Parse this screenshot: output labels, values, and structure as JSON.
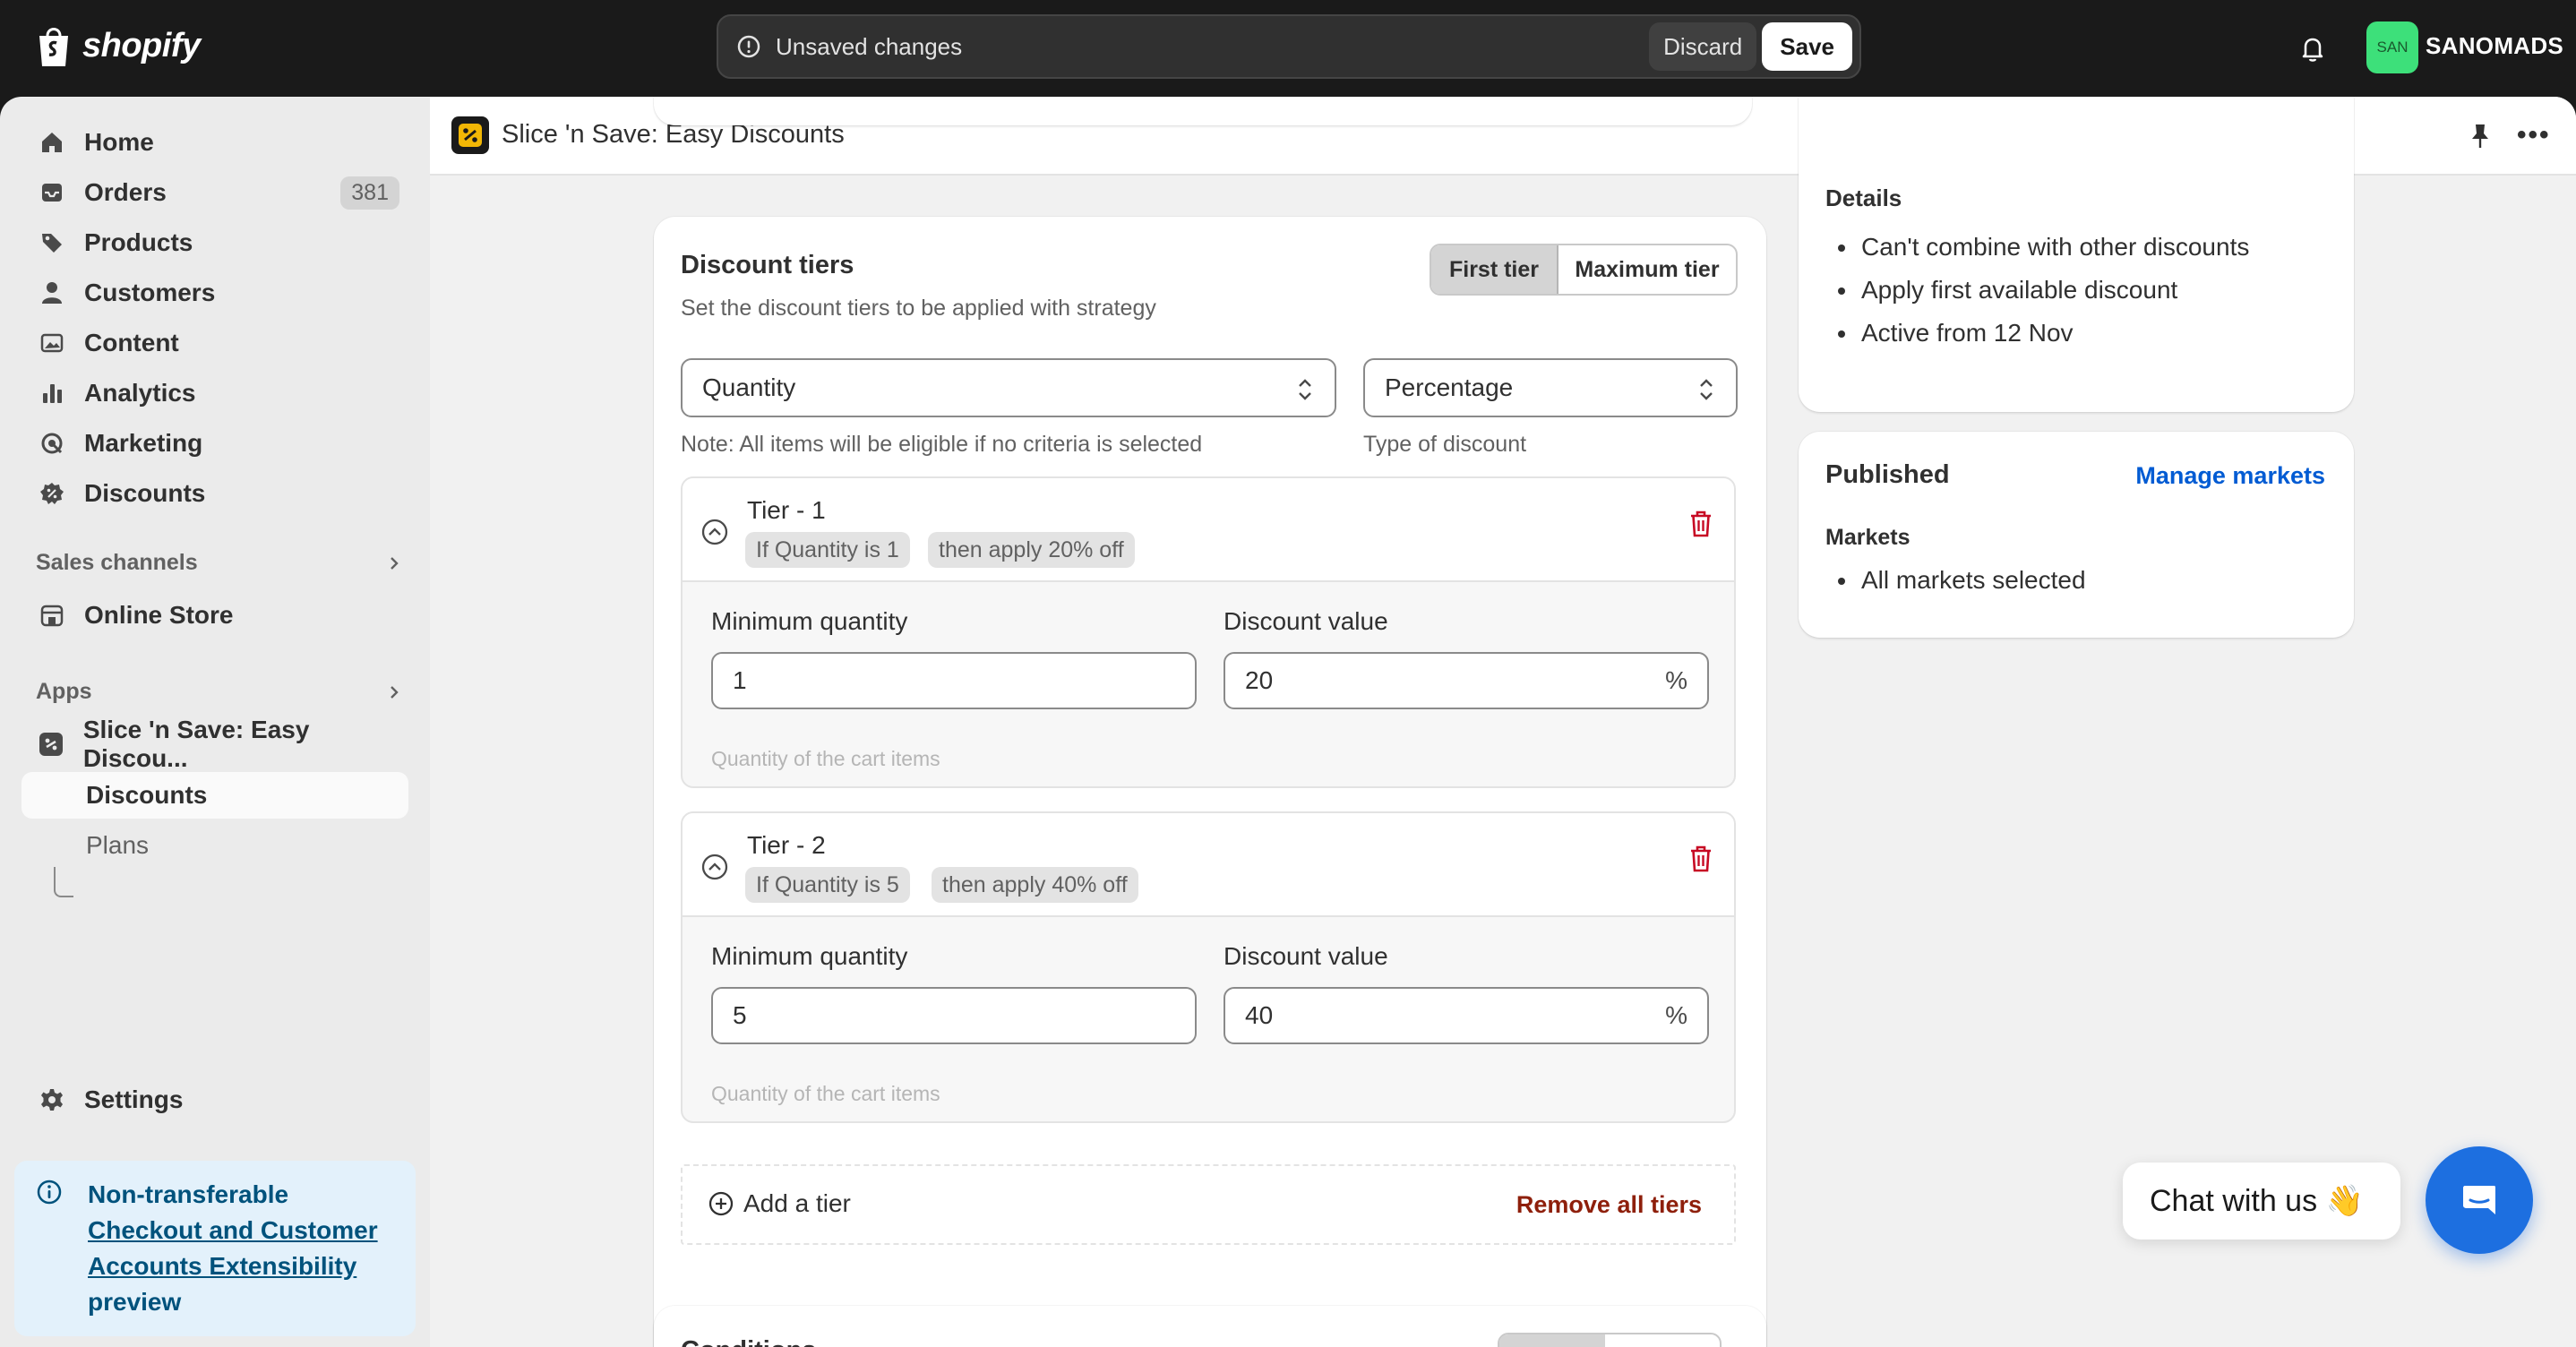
{
  "topbar": {
    "brand": "shopify",
    "unsaved_message": "Unsaved changes",
    "discard_label": "Discard",
    "save_label": "Save",
    "avatar_initials": "SAN",
    "store_name": "SANOMADS"
  },
  "sidebar": {
    "items": [
      {
        "label": "Home",
        "icon": "home-icon"
      },
      {
        "label": "Orders",
        "icon": "inbox-icon",
        "badge": "381"
      },
      {
        "label": "Products",
        "icon": "tag-icon"
      },
      {
        "label": "Customers",
        "icon": "person-icon"
      },
      {
        "label": "Content",
        "icon": "image-icon"
      },
      {
        "label": "Analytics",
        "icon": "bar-chart-icon"
      },
      {
        "label": "Marketing",
        "icon": "target-icon"
      },
      {
        "label": "Discounts",
        "icon": "discount-icon"
      }
    ],
    "sales_channels_label": "Sales channels",
    "online_store_label": "Online Store",
    "apps_label": "Apps",
    "app_name": "Slice 'n Save: Easy Discou...",
    "app_sub_items": [
      "Discounts",
      "Plans"
    ],
    "settings_label": "Settings",
    "banner": {
      "prefix": "Non-transferable",
      "link": "Checkout and Customer Accounts Extensibility",
      "suffix": "preview"
    }
  },
  "app_header": {
    "title": "Slice 'n Save: Easy Discounts"
  },
  "discount_tiers": {
    "title": "Discount tiers",
    "subtitle": "Set the discount tiers to be applied with strategy",
    "segments": [
      "First tier",
      "Maximum tier"
    ],
    "selected_segment": "First tier",
    "criteria_select": "Quantity",
    "criteria_note": "Note: All items will be eligible if no criteria is selected",
    "type_select": "Percentage",
    "type_note": "Type of discount",
    "tiers": [
      {
        "name": "Tier - 1",
        "condition_tag": "If Quantity is 1",
        "result_tag": "then apply 20% off",
        "min_label": "Minimum quantity",
        "min_value": "1",
        "min_help": "Quantity of the cart items",
        "value_label": "Discount value",
        "value": "20",
        "suffix": "%"
      },
      {
        "name": "Tier - 2",
        "condition_tag": "If Quantity is 5",
        "result_tag": "then apply 40% off",
        "min_label": "Minimum quantity",
        "min_value": "5",
        "min_help": "Quantity of the cart items",
        "value_label": "Discount value",
        "value": "40",
        "suffix": "%"
      }
    ],
    "add_tier_label": "Add a tier",
    "remove_all_label": "Remove all tiers"
  },
  "next_card": {
    "title": "Conditions"
  },
  "details": {
    "title": "Details",
    "items": [
      "Can't combine with other discounts",
      "Apply first available discount",
      "Active from 12 Nov"
    ]
  },
  "published": {
    "title": "Published",
    "manage_link": "Manage markets",
    "markets_label": "Markets",
    "markets_items": [
      "All markets selected"
    ]
  },
  "chat": {
    "label": "Chat with us 👋"
  },
  "colors": {
    "accent_blue": "#005bd3",
    "critical": "#8e1f0b",
    "chat_blue": "#1d6fe0"
  }
}
